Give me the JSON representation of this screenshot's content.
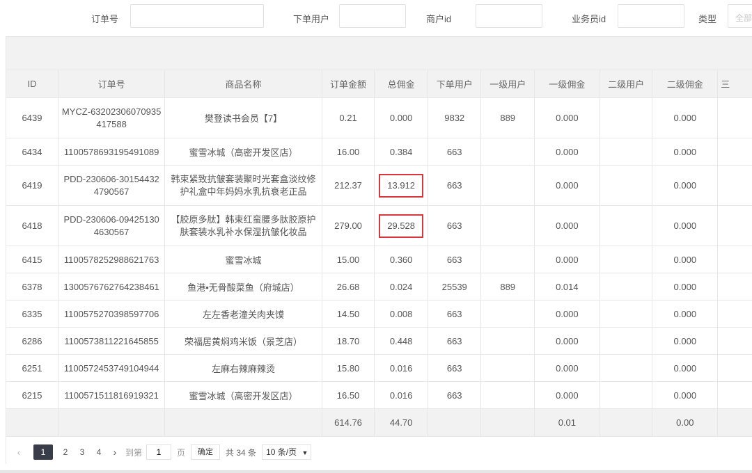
{
  "filters": {
    "order_no_label": "订单号",
    "user_label": "下单用户",
    "merchant_label": "商户id",
    "salesman_label": "业务员id",
    "type_label": "类型",
    "type_value": "全部"
  },
  "table": {
    "headers": [
      "ID",
      "订单号",
      "商品名称",
      "订单金额",
      "总佣金",
      "下单用户",
      "一级用户",
      "一级佣金",
      "二级用户",
      "二级佣金",
      "三"
    ],
    "rows": [
      {
        "id": "6439",
        "order": "MYCZ-63202306070935417588",
        "product": "樊登读书会员【7】",
        "amount": "0.21",
        "commission": "0.000",
        "user": "9832",
        "l1_user": "889",
        "l1_comm": "0.000",
        "l2_user": "",
        "l2_comm": "0.000"
      },
      {
        "id": "6434",
        "order": "1100578693195491089",
        "product": "蜜雪冰城（高密开发区店）",
        "amount": "16.00",
        "commission": "0.384",
        "user": "663",
        "l1_user": "",
        "l1_comm": "0.000",
        "l2_user": "",
        "l2_comm": "0.000"
      },
      {
        "id": "6419",
        "order": "PDD-230606-301544324790567",
        "product": "韩束紧致抗皱套装聚时光套盒淡纹修护礼盒中年妈妈水乳抗衰老正品",
        "amount": "212.37",
        "commission": "13.912",
        "user": "663",
        "l1_user": "",
        "l1_comm": "0.000",
        "l2_user": "",
        "l2_comm": "0.000"
      },
      {
        "id": "6418",
        "order": "PDD-230606-094251304630567",
        "product": "【胶原多肽】韩束红蛮腰多肽胶原护肤套装水乳补水保湿抗皱化妆品",
        "amount": "279.00",
        "commission": "29.528",
        "user": "663",
        "l1_user": "",
        "l1_comm": "0.000",
        "l2_user": "",
        "l2_comm": "0.000"
      },
      {
        "id": "6415",
        "order": "1100578252988621763",
        "product": "蜜雪冰城",
        "amount": "15.00",
        "commission": "0.360",
        "user": "663",
        "l1_user": "",
        "l1_comm": "0.000",
        "l2_user": "",
        "l2_comm": "0.000"
      },
      {
        "id": "6378",
        "order": "1300576762764238461",
        "product": "鱼港•无骨酸菜鱼（府城店）",
        "amount": "26.68",
        "commission": "0.024",
        "user": "25539",
        "l1_user": "889",
        "l1_comm": "0.014",
        "l2_user": "",
        "l2_comm": "0.000"
      },
      {
        "id": "6335",
        "order": "1100575270398597706",
        "product": "左左香老潼关肉夹馍",
        "amount": "14.50",
        "commission": "0.008",
        "user": "663",
        "l1_user": "",
        "l1_comm": "0.000",
        "l2_user": "",
        "l2_comm": "0.000"
      },
      {
        "id": "6286",
        "order": "1100573811221645855",
        "product": "荣福居黄焖鸡米饭（景芝店）",
        "amount": "18.70",
        "commission": "0.448",
        "user": "663",
        "l1_user": "",
        "l1_comm": "0.000",
        "l2_user": "",
        "l2_comm": "0.000"
      },
      {
        "id": "6251",
        "order": "1100572453749104944",
        "product": "左麻右辣麻辣烫",
        "amount": "15.80",
        "commission": "0.016",
        "user": "663",
        "l1_user": "",
        "l1_comm": "0.000",
        "l2_user": "",
        "l2_comm": "0.000"
      },
      {
        "id": "6215",
        "order": "1100571511816919321",
        "product": "蜜雪冰城（高密开发区店）",
        "amount": "16.50",
        "commission": "0.016",
        "user": "663",
        "l1_user": "",
        "l1_comm": "0.000",
        "l2_user": "",
        "l2_comm": "0.000"
      }
    ],
    "totals": {
      "amount": "614.76",
      "commission": "44.70",
      "l1_comm": "0.01",
      "l2_comm": "0.00"
    }
  },
  "pager": {
    "prev_icon": "‹",
    "pages": [
      "1",
      "2",
      "3",
      "4"
    ],
    "current": "1",
    "next_icon": "›",
    "goto_label": "到第",
    "goto_value": "1",
    "page_unit": "页",
    "confirm_label": "确定",
    "total_label": "共 34 条",
    "page_size_label": "10 条/页"
  },
  "colors": {
    "highlight": "#d9363e",
    "active_page": "#393d49",
    "header_bg": "#f2f2f2"
  }
}
